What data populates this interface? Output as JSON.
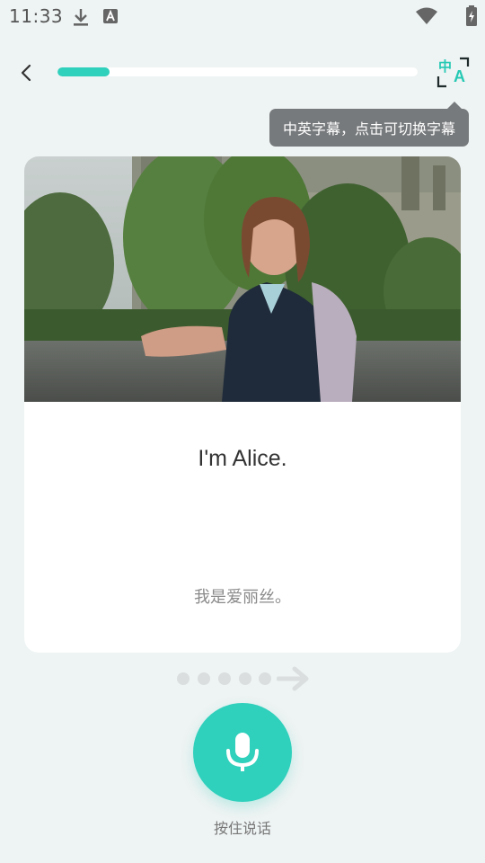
{
  "status_bar": {
    "time": "11:33",
    "icons": [
      "download-icon",
      "text-a-icon",
      "wifi-icon",
      "battery-charging-icon"
    ]
  },
  "header": {
    "back_icon": "chevron-left-icon",
    "progress_fraction": 0.145,
    "subtitle_toggle": {
      "zh_glyph": "中",
      "en_glyph": "A",
      "icon": "translate-icon"
    }
  },
  "tooltip": {
    "text": "中英字幕，点击可切换字幕"
  },
  "card": {
    "image_description_icon": "video-frame",
    "english": "I'm Alice.",
    "chinese": "我是爱丽丝。"
  },
  "pager": {
    "dot_count": 5,
    "arrow_icon": "arrow-right-icon"
  },
  "mic": {
    "icon": "microphone-icon",
    "label": "按住说话"
  },
  "colors": {
    "accent": "#2fd0bc",
    "background": "#eef3f3",
    "tooltip": "#777a7c"
  }
}
